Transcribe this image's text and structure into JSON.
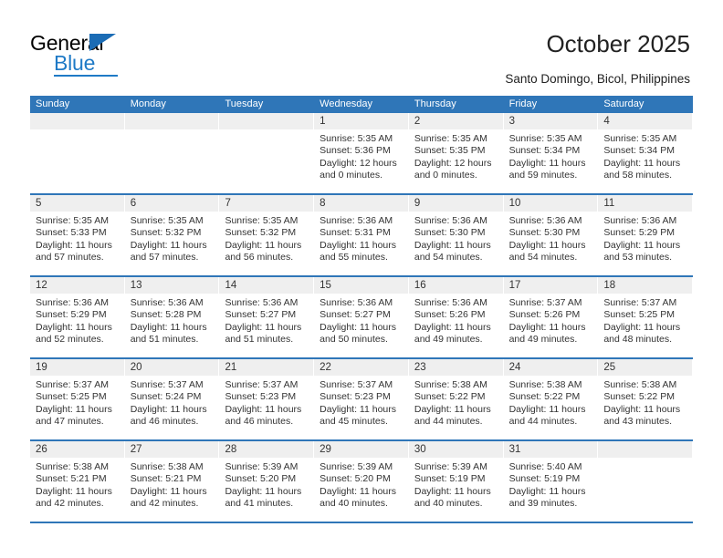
{
  "brand": {
    "name_top": "General",
    "name_bottom": "Blue",
    "accent_color": "#1f7ac6",
    "triangle_color": "#1b6cb5"
  },
  "header": {
    "title": "October 2025",
    "subtitle": "Santo Domingo, Bicol, Philippines"
  },
  "calendar": {
    "header_bg": "#2f76b8",
    "header_text_color": "#ffffff",
    "daynum_band_bg": "#efefef",
    "weekday_headers": [
      "Sunday",
      "Monday",
      "Tuesday",
      "Wednesday",
      "Thursday",
      "Friday",
      "Saturday"
    ],
    "weeks": [
      [
        {
          "day": "",
          "sunrise": "",
          "sunset": "",
          "daylight": "",
          "empty": true
        },
        {
          "day": "",
          "sunrise": "",
          "sunset": "",
          "daylight": "",
          "empty": true
        },
        {
          "day": "",
          "sunrise": "",
          "sunset": "",
          "daylight": "",
          "empty": true
        },
        {
          "day": "1",
          "sunrise": "Sunrise: 5:35 AM",
          "sunset": "Sunset: 5:36 PM",
          "daylight": "Daylight: 12 hours and 0 minutes."
        },
        {
          "day": "2",
          "sunrise": "Sunrise: 5:35 AM",
          "sunset": "Sunset: 5:35 PM",
          "daylight": "Daylight: 12 hours and 0 minutes."
        },
        {
          "day": "3",
          "sunrise": "Sunrise: 5:35 AM",
          "sunset": "Sunset: 5:34 PM",
          "daylight": "Daylight: 11 hours and 59 minutes."
        },
        {
          "day": "4",
          "sunrise": "Sunrise: 5:35 AM",
          "sunset": "Sunset: 5:34 PM",
          "daylight": "Daylight: 11 hours and 58 minutes."
        }
      ],
      [
        {
          "day": "5",
          "sunrise": "Sunrise: 5:35 AM",
          "sunset": "Sunset: 5:33 PM",
          "daylight": "Daylight: 11 hours and 57 minutes."
        },
        {
          "day": "6",
          "sunrise": "Sunrise: 5:35 AM",
          "sunset": "Sunset: 5:32 PM",
          "daylight": "Daylight: 11 hours and 57 minutes."
        },
        {
          "day": "7",
          "sunrise": "Sunrise: 5:35 AM",
          "sunset": "Sunset: 5:32 PM",
          "daylight": "Daylight: 11 hours and 56 minutes."
        },
        {
          "day": "8",
          "sunrise": "Sunrise: 5:36 AM",
          "sunset": "Sunset: 5:31 PM",
          "daylight": "Daylight: 11 hours and 55 minutes."
        },
        {
          "day": "9",
          "sunrise": "Sunrise: 5:36 AM",
          "sunset": "Sunset: 5:30 PM",
          "daylight": "Daylight: 11 hours and 54 minutes."
        },
        {
          "day": "10",
          "sunrise": "Sunrise: 5:36 AM",
          "sunset": "Sunset: 5:30 PM",
          "daylight": "Daylight: 11 hours and 54 minutes."
        },
        {
          "day": "11",
          "sunrise": "Sunrise: 5:36 AM",
          "sunset": "Sunset: 5:29 PM",
          "daylight": "Daylight: 11 hours and 53 minutes."
        }
      ],
      [
        {
          "day": "12",
          "sunrise": "Sunrise: 5:36 AM",
          "sunset": "Sunset: 5:29 PM",
          "daylight": "Daylight: 11 hours and 52 minutes."
        },
        {
          "day": "13",
          "sunrise": "Sunrise: 5:36 AM",
          "sunset": "Sunset: 5:28 PM",
          "daylight": "Daylight: 11 hours and 51 minutes."
        },
        {
          "day": "14",
          "sunrise": "Sunrise: 5:36 AM",
          "sunset": "Sunset: 5:27 PM",
          "daylight": "Daylight: 11 hours and 51 minutes."
        },
        {
          "day": "15",
          "sunrise": "Sunrise: 5:36 AM",
          "sunset": "Sunset: 5:27 PM",
          "daylight": "Daylight: 11 hours and 50 minutes."
        },
        {
          "day": "16",
          "sunrise": "Sunrise: 5:36 AM",
          "sunset": "Sunset: 5:26 PM",
          "daylight": "Daylight: 11 hours and 49 minutes."
        },
        {
          "day": "17",
          "sunrise": "Sunrise: 5:37 AM",
          "sunset": "Sunset: 5:26 PM",
          "daylight": "Daylight: 11 hours and 49 minutes."
        },
        {
          "day": "18",
          "sunrise": "Sunrise: 5:37 AM",
          "sunset": "Sunset: 5:25 PM",
          "daylight": "Daylight: 11 hours and 48 minutes."
        }
      ],
      [
        {
          "day": "19",
          "sunrise": "Sunrise: 5:37 AM",
          "sunset": "Sunset: 5:25 PM",
          "daylight": "Daylight: 11 hours and 47 minutes."
        },
        {
          "day": "20",
          "sunrise": "Sunrise: 5:37 AM",
          "sunset": "Sunset: 5:24 PM",
          "daylight": "Daylight: 11 hours and 46 minutes."
        },
        {
          "day": "21",
          "sunrise": "Sunrise: 5:37 AM",
          "sunset": "Sunset: 5:23 PM",
          "daylight": "Daylight: 11 hours and 46 minutes."
        },
        {
          "day": "22",
          "sunrise": "Sunrise: 5:37 AM",
          "sunset": "Sunset: 5:23 PM",
          "daylight": "Daylight: 11 hours and 45 minutes."
        },
        {
          "day": "23",
          "sunrise": "Sunrise: 5:38 AM",
          "sunset": "Sunset: 5:22 PM",
          "daylight": "Daylight: 11 hours and 44 minutes."
        },
        {
          "day": "24",
          "sunrise": "Sunrise: 5:38 AM",
          "sunset": "Sunset: 5:22 PM",
          "daylight": "Daylight: 11 hours and 44 minutes."
        },
        {
          "day": "25",
          "sunrise": "Sunrise: 5:38 AM",
          "sunset": "Sunset: 5:22 PM",
          "daylight": "Daylight: 11 hours and 43 minutes."
        }
      ],
      [
        {
          "day": "26",
          "sunrise": "Sunrise: 5:38 AM",
          "sunset": "Sunset: 5:21 PM",
          "daylight": "Daylight: 11 hours and 42 minutes."
        },
        {
          "day": "27",
          "sunrise": "Sunrise: 5:38 AM",
          "sunset": "Sunset: 5:21 PM",
          "daylight": "Daylight: 11 hours and 42 minutes."
        },
        {
          "day": "28",
          "sunrise": "Sunrise: 5:39 AM",
          "sunset": "Sunset: 5:20 PM",
          "daylight": "Daylight: 11 hours and 41 minutes."
        },
        {
          "day": "29",
          "sunrise": "Sunrise: 5:39 AM",
          "sunset": "Sunset: 5:20 PM",
          "daylight": "Daylight: 11 hours and 40 minutes."
        },
        {
          "day": "30",
          "sunrise": "Sunrise: 5:39 AM",
          "sunset": "Sunset: 5:19 PM",
          "daylight": "Daylight: 11 hours and 40 minutes."
        },
        {
          "day": "31",
          "sunrise": "Sunrise: 5:40 AM",
          "sunset": "Sunset: 5:19 PM",
          "daylight": "Daylight: 11 hours and 39 minutes."
        },
        {
          "day": "",
          "sunrise": "",
          "sunset": "",
          "daylight": "",
          "empty": true
        }
      ]
    ]
  }
}
